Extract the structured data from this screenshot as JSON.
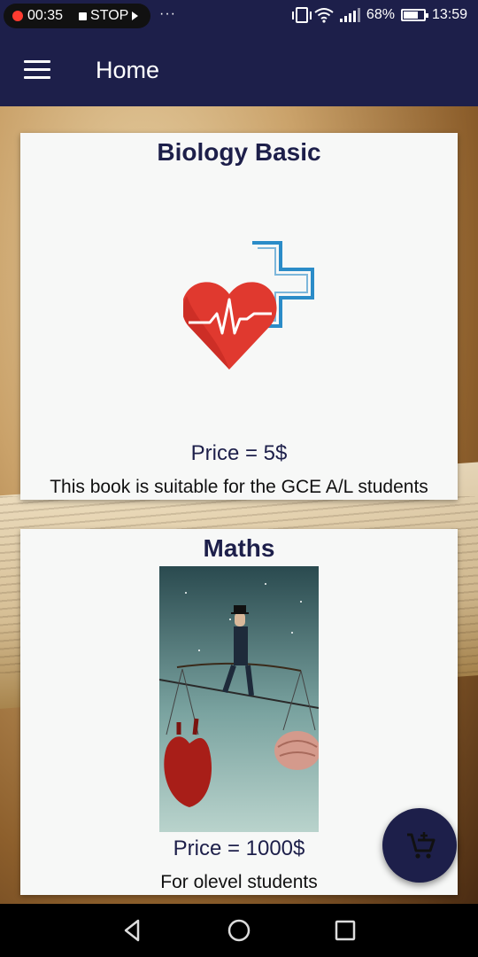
{
  "status_bar": {
    "record_time": "00:35",
    "stop_label": "STOP",
    "more": "···",
    "battery": "68%",
    "clock": "13:59"
  },
  "app_bar": {
    "title": "Home"
  },
  "books": [
    {
      "title": "Biology Basic",
      "price": "Price = 5$",
      "description": "This book is suitable for the GCE A/L students"
    },
    {
      "title": "Maths",
      "price": "Price = 1000$",
      "description": "For olevel students"
    }
  ],
  "colors": {
    "primary": "#1d1f4a",
    "card": "#f7f8f7",
    "heart": "#e0392f",
    "cross": "#2b8cc8"
  },
  "icons": {
    "menu": "menu-icon",
    "cart": "add-to-cart-icon",
    "back": "back-icon",
    "home": "home-icon",
    "recent": "recent-apps-icon"
  }
}
